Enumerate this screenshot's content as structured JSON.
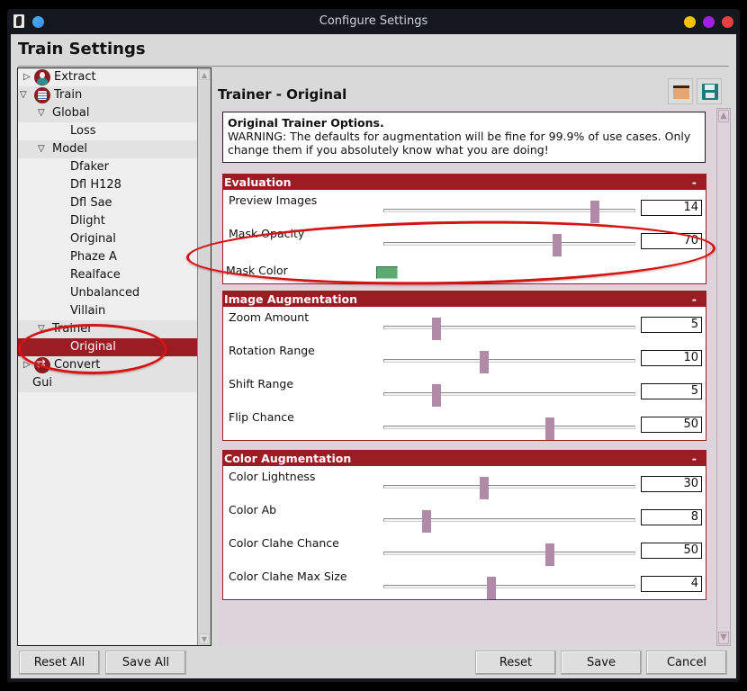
{
  "window": {
    "title": "Configure Settings",
    "controls": [
      "minimize",
      "maximize",
      "close"
    ],
    "colors": {
      "minimize": "#f2c300",
      "maximize": "#a020e0",
      "close": "#e84040",
      "accent": "#9b1c22"
    }
  },
  "page": {
    "title": "Train Settings"
  },
  "tree": {
    "items": [
      {
        "label": "Extract",
        "level": 0,
        "expander": "collapsed",
        "icon": "extract-icon"
      },
      {
        "label": "Train",
        "level": 0,
        "expander": "expanded",
        "icon": "train-icon"
      },
      {
        "label": "Global",
        "level": 1,
        "expander": "expanded"
      },
      {
        "label": "Loss",
        "level": 2
      },
      {
        "label": "Model",
        "level": 1,
        "expander": "expanded"
      },
      {
        "label": "Dfaker",
        "level": 2
      },
      {
        "label": "Dfl H128",
        "level": 2
      },
      {
        "label": "Dfl Sae",
        "level": 2
      },
      {
        "label": "Dlight",
        "level": 2
      },
      {
        "label": "Original",
        "level": 2
      },
      {
        "label": "Phaze A",
        "level": 2
      },
      {
        "label": "Realface",
        "level": 2
      },
      {
        "label": "Unbalanced",
        "level": 2
      },
      {
        "label": "Villain",
        "level": 2
      },
      {
        "label": "Trainer",
        "level": 1,
        "expander": "expanded"
      },
      {
        "label": "Original",
        "level": 2,
        "selected": true
      },
      {
        "label": "Convert",
        "level": 0,
        "expander": "collapsed",
        "icon": "convert-icon"
      },
      {
        "label": "Gui",
        "level": 0
      }
    ]
  },
  "panel": {
    "title": "Trainer - Original",
    "info_heading": "Original Trainer Options.",
    "info_text": "WARNING: The defaults for augmentation will be fine for 99.9% of use cases. Only change them if you absolutely know what you are doing!",
    "groups": [
      {
        "title": "Evaluation",
        "collapse": "-",
        "options": [
          {
            "label": "Preview Images",
            "type": "slider",
            "value": "14",
            "fraction": 0.84
          },
          {
            "label": "Mask Opacity",
            "type": "slider",
            "value": "70",
            "fraction": 0.69
          },
          {
            "label": "Mask Color",
            "type": "color",
            "value": "#5aaa72"
          }
        ]
      },
      {
        "title": "Image Augmentation",
        "collapse": "-",
        "options": [
          {
            "label": "Zoom Amount",
            "type": "slider",
            "value": "5",
            "fraction": 0.21
          },
          {
            "label": "Rotation Range",
            "type": "slider",
            "value": "10",
            "fraction": 0.4
          },
          {
            "label": "Shift Range",
            "type": "slider",
            "value": "5",
            "fraction": 0.21
          },
          {
            "label": "Flip Chance",
            "type": "slider",
            "value": "50",
            "fraction": 0.66
          }
        ]
      },
      {
        "title": "Color Augmentation",
        "collapse": "-",
        "options": [
          {
            "label": "Color Lightness",
            "type": "slider",
            "value": "30",
            "fraction": 0.4
          },
          {
            "label": "Color Ab",
            "type": "slider",
            "value": "8",
            "fraction": 0.17
          },
          {
            "label": "Color Clahe Chance",
            "type": "slider",
            "value": "50",
            "fraction": 0.66
          },
          {
            "label": "Color Clahe Max Size",
            "type": "slider",
            "value": "4",
            "fraction": 0.43
          }
        ]
      }
    ]
  },
  "toolbar": {
    "load_icon": "folder-icon",
    "save_icon": "floppy-disk-icon"
  },
  "buttons": {
    "reset_all": "Reset All",
    "save_all": "Save All",
    "reset": "Reset",
    "save": "Save",
    "cancel": "Cancel"
  },
  "annotations": [
    {
      "shape": "ellipse",
      "color": "#d41414",
      "around": "Mask Opacity / Mask Color"
    },
    {
      "shape": "ellipse",
      "color": "#d41414",
      "around": "Trainer > Original"
    }
  ]
}
